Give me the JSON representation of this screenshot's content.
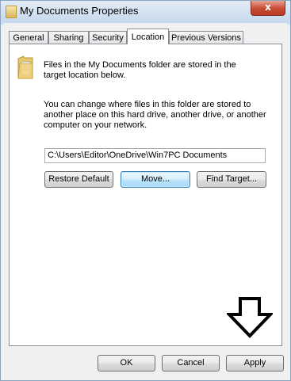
{
  "window": {
    "title": "My Documents Properties",
    "close_label": "x"
  },
  "tabs": [
    {
      "label": "General"
    },
    {
      "label": "Sharing"
    },
    {
      "label": "Security"
    },
    {
      "label": "Location",
      "active": true
    },
    {
      "label": "Previous Versions"
    }
  ],
  "location": {
    "intro_line1": "Files in the My Documents folder are stored in the",
    "intro_line2": "target location below.",
    "info_line1": "You can change where files in this folder are stored to",
    "info_line2": "another place on this hard drive, another drive, or another",
    "info_line3": "computer on your network.",
    "path_value": "C:\\Users\\Editor\\OneDrive\\Win7PC Documents",
    "restore_default_label": "Restore Default",
    "move_label": "Move...",
    "find_target_label": "Find Target..."
  },
  "footer": {
    "ok_label": "OK",
    "cancel_label": "Cancel",
    "apply_label": "Apply"
  },
  "icons": {
    "title_icon": "folder-icon",
    "location_icon": "documents-folder-icon",
    "annotation": "down-arrow-icon"
  }
}
